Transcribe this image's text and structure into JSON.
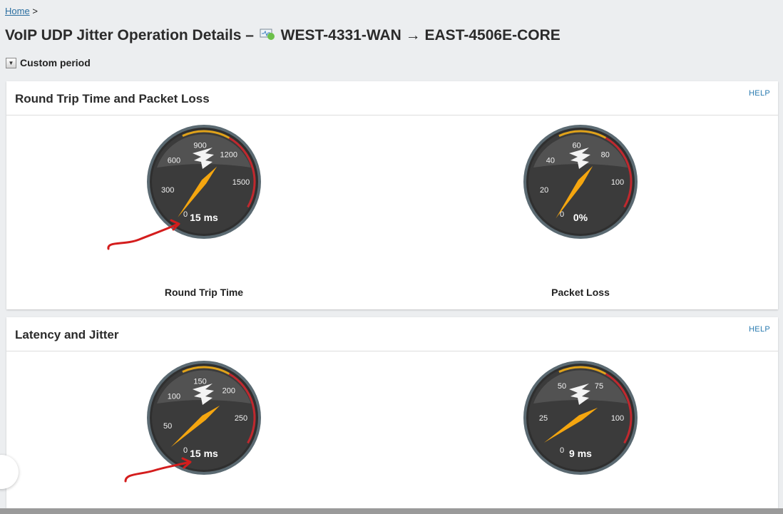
{
  "breadcrumb": {
    "home": "Home",
    "separator": ">"
  },
  "title": {
    "prefix": "VoIP UDP Jitter Operation Details –",
    "icon": "node-status-icon",
    "status_color": "#6cc04a",
    "route": "WEST-4331-WAN → EAST-4506E-CORE"
  },
  "period": {
    "label": "Custom period"
  },
  "panels": [
    {
      "title": "Round Trip Time and Packet Loss",
      "help": "HELP",
      "gauges": [
        {
          "label": "Round Trip Time",
          "readout": "15 ms",
          "ticks": [
            "0",
            "300",
            "600",
            "900",
            "1200",
            "1500"
          ],
          "min": 0,
          "max": 1500,
          "value": 15
        },
        {
          "label": "Packet Loss",
          "readout": "0%",
          "ticks": [
            "0",
            "20",
            "40",
            "60",
            "80",
            "100"
          ],
          "min": 0,
          "max": 100,
          "value": 0
        }
      ]
    },
    {
      "title": "Latency and Jitter",
      "help": "HELP",
      "gauges": [
        {
          "readout": "15 ms",
          "ticks": [
            "0",
            "50",
            "100",
            "150",
            "200",
            "250"
          ],
          "min": 0,
          "max": 250,
          "value": 15
        },
        {
          "readout": "9 ms",
          "ticks": [
            "0",
            "25",
            "50",
            "75",
            "100"
          ],
          "min": 0,
          "max": 100,
          "value": 9
        }
      ]
    }
  ],
  "colors": {
    "accent": "#2a7bb0",
    "needle": "#f5a60f",
    "warning_arc": "#e0a21a",
    "critical_arc": "#c0282e",
    "gauge_face": "#3b3b3b"
  }
}
